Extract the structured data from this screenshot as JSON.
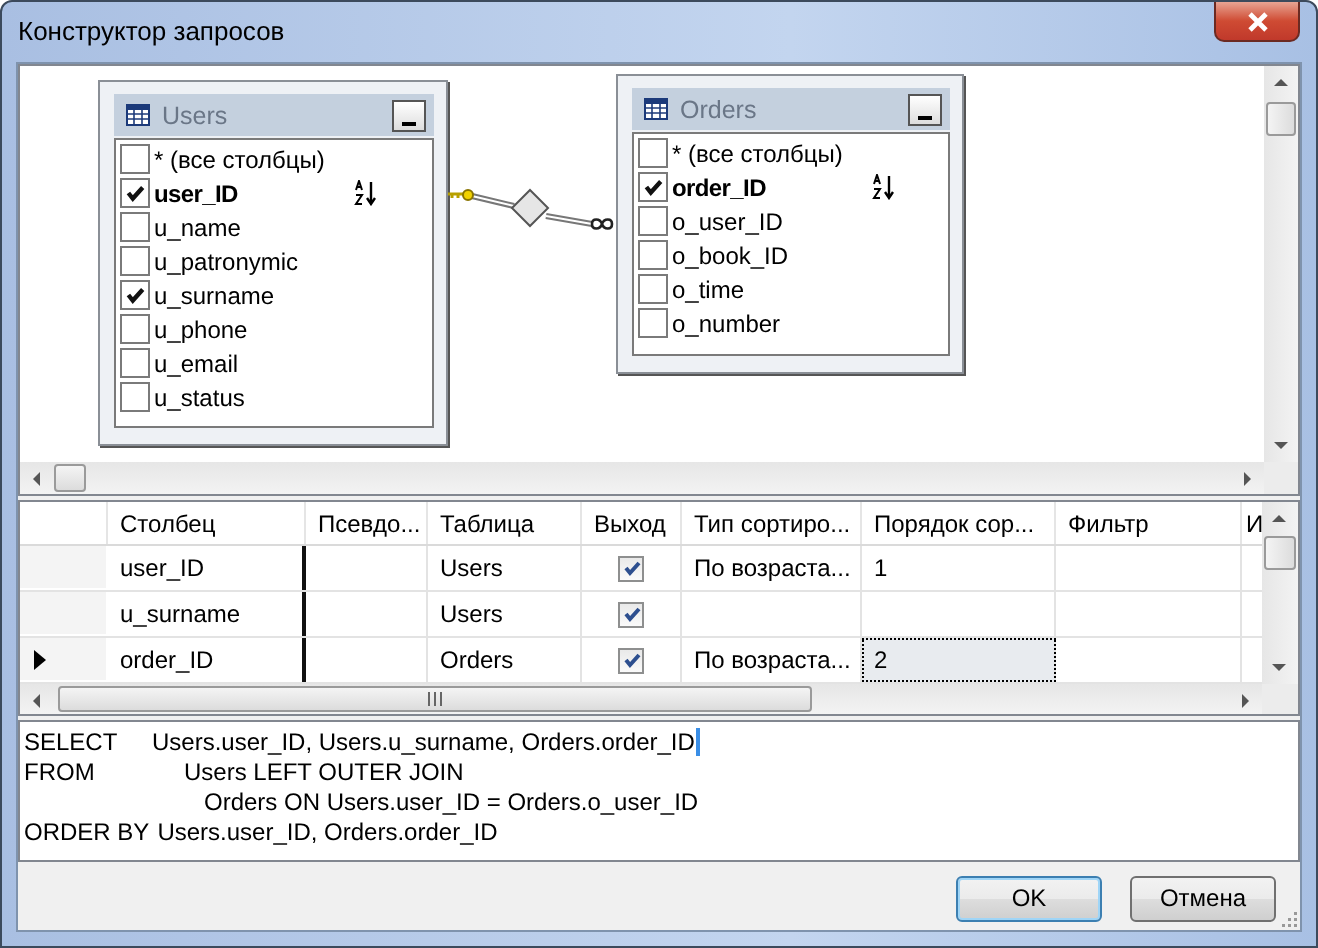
{
  "window": {
    "title": "Конструктор запросов"
  },
  "diagram": {
    "tables": [
      {
        "name": "Users",
        "fields": [
          {
            "label": "* (все столбцы)",
            "checked": false,
            "key": false,
            "sorted": false
          },
          {
            "label": "user_ID",
            "checked": true,
            "key": true,
            "sorted": true
          },
          {
            "label": "u_name",
            "checked": false,
            "key": false,
            "sorted": false
          },
          {
            "label": "u_patronymic",
            "checked": false,
            "key": false,
            "sorted": false
          },
          {
            "label": "u_surname",
            "checked": true,
            "key": false,
            "sorted": false
          },
          {
            "label": "u_phone",
            "checked": false,
            "key": false,
            "sorted": false
          },
          {
            "label": "u_email",
            "checked": false,
            "key": false,
            "sorted": false
          },
          {
            "label": "u_status",
            "checked": false,
            "key": false,
            "sorted": false
          }
        ]
      },
      {
        "name": "Orders",
        "fields": [
          {
            "label": "* (все столбцы)",
            "checked": false,
            "key": false,
            "sorted": false
          },
          {
            "label": "order_ID",
            "checked": true,
            "key": true,
            "sorted": true
          },
          {
            "label": "o_user_ID",
            "checked": false,
            "key": false,
            "sorted": false
          },
          {
            "label": "o_book_ID",
            "checked": false,
            "key": false,
            "sorted": false
          },
          {
            "label": "o_time",
            "checked": false,
            "key": false,
            "sorted": false
          },
          {
            "label": "o_number",
            "checked": false,
            "key": false,
            "sorted": false
          }
        ]
      }
    ]
  },
  "grid": {
    "columns": [
      "Столбец",
      "Псевдо...",
      "Таблица",
      "Выход",
      "Тип сортиро...",
      "Порядок сор...",
      "Фильтр",
      "И"
    ],
    "rows": [
      {
        "column": "user_ID",
        "table": "Users",
        "output": true,
        "sort_type": "По возраста...",
        "sort_order": "1",
        "current": false,
        "focused": false
      },
      {
        "column": "u_surname",
        "table": "Users",
        "output": true,
        "current": false,
        "focused": false
      },
      {
        "column": "order_ID",
        "table": "Orders",
        "output": true,
        "sort_type": "По возраста...",
        "sort_order": "2",
        "current": true,
        "focused": true
      }
    ]
  },
  "sql": {
    "lines": [
      {
        "keyword": "SELECT",
        "text": "Users.user_ID, Users.u_surname, Orders.order_ID"
      },
      {
        "keyword": "FROM",
        "text": "Users LEFT OUTER JOIN"
      },
      {
        "text": "Orders ON Users.user_ID = Orders.o_user_ID"
      },
      {
        "keyword": "ORDER BY",
        "text": "Users.user_ID, Orders.order_ID"
      }
    ]
  },
  "buttons": [
    {
      "label": "OK",
      "default": true
    },
    {
      "label": "Отмена",
      "default": false
    }
  ]
}
